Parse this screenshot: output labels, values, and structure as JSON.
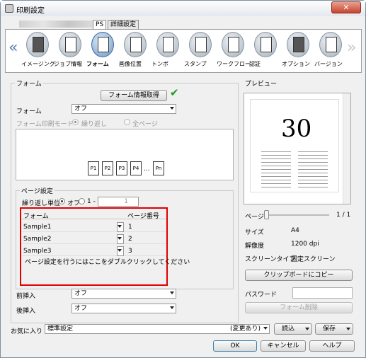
{
  "window": {
    "title": "印刷設定",
    "close": "✕"
  },
  "tabs": [
    "PS",
    "詳細設定"
  ],
  "ribbon": {
    "items": [
      "イメージング",
      "ジョブ情報",
      "フォーム",
      "画像位置",
      "トンボ",
      "スタンプ",
      "ワークフロー",
      "認証",
      "オプション",
      "バージョン"
    ],
    "active": 2,
    "left_arrow": "«",
    "right_arrow": "»"
  },
  "form": {
    "group_title": "フォーム",
    "info_button": "フォーム情報取得",
    "check_icon": "✔",
    "form_label": "フォーム",
    "form_value": "オフ",
    "mode_label": "フォーム印刷モード",
    "mode_repeat": "繰り返し",
    "mode_all": "全ページ",
    "pages": [
      "P1",
      "P2",
      "P3",
      "P4",
      "...",
      "Pn"
    ]
  },
  "page_setting": {
    "title": "ページ設定",
    "unit_label": "繰り返し単位",
    "off": "オフ",
    "one": "1 -",
    "range_value": "1",
    "col_form": "フォーム",
    "col_page": "ページ番号",
    "rows": [
      {
        "form": "Sample1",
        "page": "1"
      },
      {
        "form": "Sample2",
        "page": "2"
      },
      {
        "form": "Sample3",
        "page": "3"
      }
    ],
    "hint": "ページ設定を行うにはここをダブルクリックしてください"
  },
  "insert": {
    "front_label": "前挿入",
    "front_value": "オフ",
    "back_label": "後挿入",
    "back_value": "オフ"
  },
  "preview": {
    "title": "プレビュー",
    "number": "30",
    "page_label": "ページ",
    "page_count": "1 / 1",
    "size_label": "サイズ",
    "size_value": "A4",
    "res_label": "解像度",
    "res_value": "1200 dpi",
    "screen_label": "スクリーンタイプ",
    "screen_value": "固定スクリーン",
    "copy_button": "クリップボードにコピー",
    "password_label": "パスワード",
    "delete_button": "フォーム削除"
  },
  "footer": {
    "fav_label": "お気に入り",
    "fav_value": "標準設定",
    "changed": "(変更あり)",
    "load": "読込",
    "save": "保存",
    "ok": "OK",
    "cancel": "キャンセル",
    "help": "ヘルプ"
  }
}
